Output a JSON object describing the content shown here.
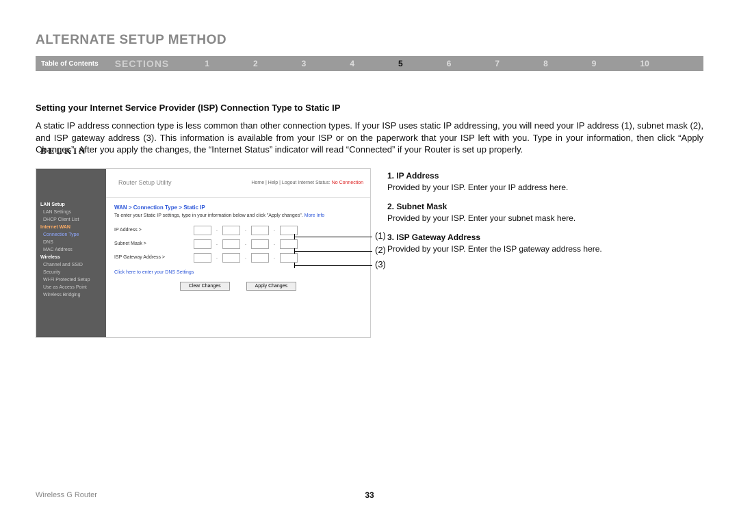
{
  "title": "ALTERNATE SETUP METHOD",
  "nav": {
    "toc": "Table of Contents",
    "sections_label": "sections",
    "sections": [
      "1",
      "2",
      "3",
      "4",
      "5",
      "6",
      "7",
      "8",
      "9",
      "10"
    ],
    "active": "5"
  },
  "subheading": "Setting your Internet Service Provider (ISP) Connection Type to Static IP",
  "paragraph": "A static IP address connection type is less common than other connection types. If your ISP uses static IP addressing, you will need your IP address (1), subnet mask (2), and ISP gateway address (3). This information is available from your ISP or on the paperwork that your ISP left with you. Type in your information, then click “Apply Changes”. After you apply the changes, the “Internet Status” indicator will read “Connected” if your Router is set up properly.",
  "router": {
    "brand": "BELKIN",
    "util": "Router Setup Utility",
    "hdr_links": "Home | Help | Logout   Internet Status:",
    "hdr_status": "No Connection",
    "sidebar": {
      "lan_setup": "LAN Setup",
      "lan_settings": "LAN Settings",
      "dhcp": "DHCP Client List",
      "internet_wan": "Internet WAN",
      "conn_type": "Connection Type",
      "dns": "DNS",
      "mac": "MAC Address",
      "wireless": "Wireless",
      "chan": "Channel and SSID",
      "security": "Security",
      "wps": "Wi-Fi Protected Setup",
      "ap": "Use as Access Point",
      "bridge": "Wireless Bridging"
    },
    "breadcrumb": "WAN > Connection Type > Static IP",
    "instr": "To enter your Static IP settings, type in your information below and click \"Apply changes\".",
    "more_info": "More Info",
    "fields": {
      "ip": "IP Address >",
      "subnet": "Subnet Mask >",
      "gateway": "ISP Gateway Address >"
    },
    "dns_link": "Click here to enter your DNS Settings",
    "clear_btn": "Clear Changes",
    "apply_btn": "Apply Changes"
  },
  "annotations": {
    "a1": "(1)",
    "a2": "(2)",
    "a3": "(3)"
  },
  "list": {
    "i1_label": "1.   IP Address",
    "i1_text": "Provided by your ISP. Enter your IP address here.",
    "i2_label": "2.   Subnet Mask",
    "i2_text": "Provided by your ISP. Enter your subnet mask here.",
    "i3_label": "3.   ISP Gateway Address",
    "i3_text": "Provided by your ISP. Enter the ISP gateway address here."
  },
  "footer": {
    "product": "Wireless G Router",
    "page": "33"
  }
}
